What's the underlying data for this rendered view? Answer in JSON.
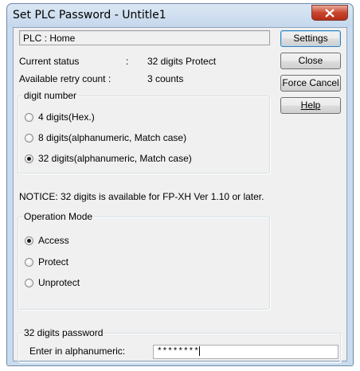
{
  "window": {
    "title": "Set PLC Password - Untitle1"
  },
  "plc": {
    "label": "PLC : Home"
  },
  "status": {
    "current_label": "Current status",
    "sep": ":",
    "current_value": "32 digits Protect",
    "retry_label": "Available retry count :",
    "retry_value": "3 counts"
  },
  "buttons": {
    "settings": "Settings",
    "close": "Close",
    "force_cancel": "Force Cancel",
    "help": "Help"
  },
  "digit_number": {
    "title": "digit number",
    "options": [
      {
        "label": "4 digits(Hex.)",
        "selected": false
      },
      {
        "label": "8 digits(alphanumeric, Match case)",
        "selected": false
      },
      {
        "label": "32 digits(alphanumeric, Match case)",
        "selected": true
      }
    ]
  },
  "notice": "NOTICE: 32 digits is available for FP-XH Ver 1.10 or later.",
  "operation_mode": {
    "title": "Operation Mode",
    "options": [
      {
        "label": "Access",
        "selected": true
      },
      {
        "label": "Protect",
        "selected": false
      },
      {
        "label": "Unprotect",
        "selected": false
      }
    ]
  },
  "password": {
    "title": "32 digits password",
    "field_label": "Enter in alphanumeric:",
    "value": "********"
  }
}
